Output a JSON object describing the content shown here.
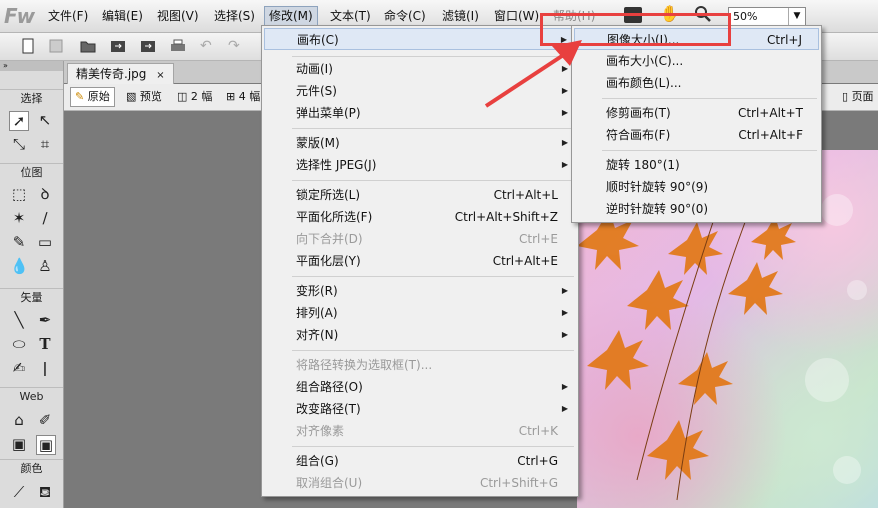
{
  "app": {
    "logo": "Fw"
  },
  "menubar": {
    "items": [
      "文件(F)",
      "编辑(E)",
      "视图(V)",
      "选择(S)",
      "修改(M)",
      "文本(T)",
      "命令(C)",
      "滤镜(I)",
      "窗口(W)",
      "帮助(H)"
    ],
    "zoom": "50%"
  },
  "document": {
    "tab_title": "精美传奇.jpg",
    "tab_close": "×",
    "view_buttons": [
      "原始",
      "预览",
      "2 幅",
      "4 幅"
    ],
    "right_label": "页面"
  },
  "tools": {
    "sections": [
      "选择",
      "位图",
      "矢量",
      "Web",
      "颜色"
    ]
  },
  "modify_menu": {
    "items": [
      {
        "label": "画布(C)",
        "submenu": true,
        "highlighted": true
      },
      {
        "label": "动画(I)",
        "submenu": true
      },
      {
        "label": "元件(S)",
        "submenu": true
      },
      {
        "label": "弹出菜单(P)",
        "submenu": true
      },
      {
        "label": "蒙版(M)",
        "submenu": true
      },
      {
        "label": "选择性 JPEG(J)",
        "submenu": true
      },
      {
        "label": "锁定所选(L)",
        "shortcut": "Ctrl+Alt+L"
      },
      {
        "label": "平面化所选(F)",
        "shortcut": "Ctrl+Alt+Shift+Z"
      },
      {
        "label": "向下合并(D)",
        "shortcut": "Ctrl+E",
        "disabled": true
      },
      {
        "label": "平面化层(Y)",
        "shortcut": "Ctrl+Alt+E"
      },
      {
        "label": "变形(R)",
        "submenu": true
      },
      {
        "label": "排列(A)",
        "submenu": true
      },
      {
        "label": "对齐(N)",
        "submenu": true
      },
      {
        "label": "将路径转换为选取框(T)...",
        "disabled": true
      },
      {
        "label": "组合路径(O)",
        "submenu": true
      },
      {
        "label": "改变路径(T)",
        "submenu": true
      },
      {
        "label": "对齐像素",
        "shortcut": "Ctrl+K",
        "disabled": true
      },
      {
        "label": "组合(G)",
        "shortcut": "Ctrl+G"
      },
      {
        "label": "取消组合(U)",
        "shortcut": "Ctrl+Shift+G",
        "disabled": true
      }
    ]
  },
  "canvas_submenu": {
    "items": [
      {
        "label": "图像大小(I)...",
        "shortcut": "Ctrl+J",
        "highlighted": true
      },
      {
        "label": "画布大小(C)..."
      },
      {
        "label": "画布颜色(L)..."
      },
      {
        "label": "修剪画布(T)",
        "shortcut": "Ctrl+Alt+T"
      },
      {
        "label": "符合画布(F)",
        "shortcut": "Ctrl+Alt+F"
      },
      {
        "label": "旋转 180°(1)"
      },
      {
        "label": "顺时针旋转 90°(9)"
      },
      {
        "label": "逆时针旋转 90°(0)"
      }
    ]
  },
  "annotation": {
    "color": "#e8403f"
  }
}
